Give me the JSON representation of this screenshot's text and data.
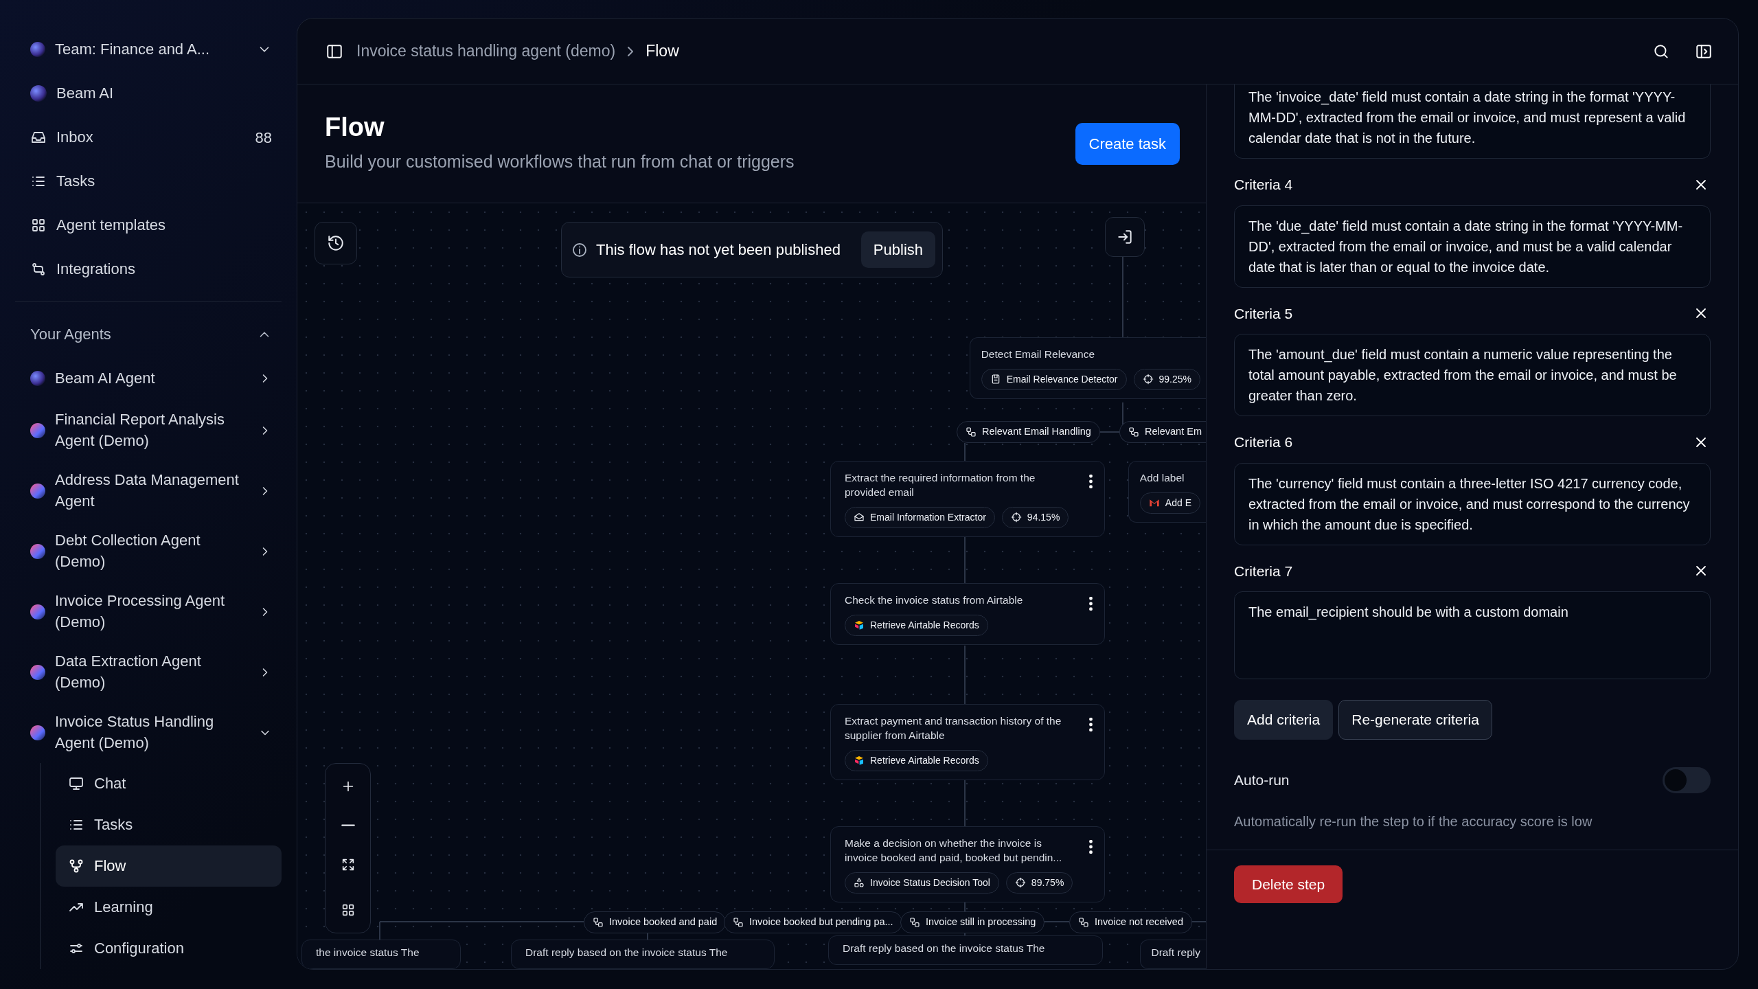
{
  "sidebar": {
    "team": {
      "label": "Team: Finance and A..."
    },
    "nav": [
      {
        "label": "Beam AI"
      },
      {
        "label": "Inbox",
        "count": "88"
      },
      {
        "label": "Tasks"
      },
      {
        "label": "Agent templates"
      },
      {
        "label": "Integrations"
      }
    ],
    "agents_section": {
      "title": "Your Agents",
      "expanded": true,
      "agents": [
        {
          "label": "Beam AI Agent",
          "expanded": false
        },
        {
          "label": "Financial Report Analysis Agent (Demo)",
          "expanded": false
        },
        {
          "label": "Address Data Management Agent",
          "expanded": false
        },
        {
          "label": "Debt Collection Agent (Demo)",
          "expanded": false
        },
        {
          "label": "Invoice Processing Agent (Demo)",
          "expanded": false
        },
        {
          "label": "Data Extraction Agent (Demo)",
          "expanded": false
        },
        {
          "label": "Invoice Status Handling Agent (Demo)",
          "expanded": true,
          "children": [
            {
              "label": "Chat",
              "selected": false
            },
            {
              "label": "Tasks",
              "selected": false
            },
            {
              "label": "Flow",
              "selected": true
            },
            {
              "label": "Learning",
              "selected": false
            },
            {
              "label": "Configuration",
              "selected": false
            }
          ]
        }
      ]
    }
  },
  "header": {
    "breadcrumb": [
      "Invoice status handling agent (demo)",
      "Flow"
    ]
  },
  "page": {
    "title": "Flow",
    "subtitle": "Build your customised workflows that run from chat or triggers",
    "create_button": "Create task"
  },
  "canvas": {
    "banner": {
      "message": "This flow has not yet been published",
      "action": "Publish"
    },
    "nodes": [
      {
        "title": "Detect Email Relevance",
        "tool": "Email Relevance Detector",
        "score": "99.25%",
        "menu": false
      },
      {
        "title": "Extract the required information from the provided email",
        "tool": "Email Information Extractor",
        "score": "94.15%",
        "menu": true
      },
      {
        "title": "Add label",
        "tool": "Add E",
        "menu": false
      },
      {
        "title": "Check the invoice status from Airtable",
        "tool": "Retrieve Airtable Records",
        "menu": true
      },
      {
        "title": "Extract payment and transaction history of the supplier from Airtable",
        "tool": "Retrieve Airtable Records",
        "menu": true
      },
      {
        "title": "Make a decision on whether the invoice is invoice booked and paid, booked but pendin...",
        "tool": "Invoice Status Decision Tool",
        "score": "89.75%",
        "menu": true
      },
      {
        "title": "the invoice status The",
        "menu": false
      },
      {
        "title": "Draft reply based on the invoice status The",
        "menu": false
      },
      {
        "title": "Draft reply based on the invoice status The",
        "menu": false
      },
      {
        "title": "Draft reply",
        "menu": false
      }
    ],
    "edge_labels": [
      "Relevant Email Handling",
      "Relevant Em",
      "Invoice booked and paid",
      "Invoice booked but pending pa...",
      "Invoice still in processing",
      "Invoice not received"
    ]
  },
  "right_panel": {
    "criteria": [
      {
        "text": "The 'invoice_date' field must contain a date string in the format 'YYYY-MM-DD', extracted from the email or invoice, and must represent a valid calendar date that is not in the future."
      },
      {
        "label": "Criteria 4",
        "text": "The 'due_date' field must contain a date string in the format 'YYYY-MM-DD', extracted from the email or invoice, and must be a valid calendar date that is later than or equal to the invoice date."
      },
      {
        "label": "Criteria 5",
        "text": "The 'amount_due' field must contain a numeric value representing the total amount payable, extracted from the email or invoice, and must be greater than zero."
      },
      {
        "label": "Criteria 6",
        "text": "The 'currency' field must contain a three-letter ISO 4217 currency code, extracted from the email or invoice, and must correspond to the currency in which the amount due is specified."
      },
      {
        "label": "Criteria 7",
        "text": "The email_recipient should be with a custom domain"
      }
    ],
    "buttons": [
      {
        "label": "Add criteria",
        "kind": "filled"
      },
      {
        "label": "Re-generate criteria",
        "kind": "outline"
      }
    ],
    "auto_run": {
      "label": "Auto-run",
      "on": false,
      "description": "Automatically re-run the step to if the accuracy score is low"
    },
    "delete_button": "Delete step"
  }
}
